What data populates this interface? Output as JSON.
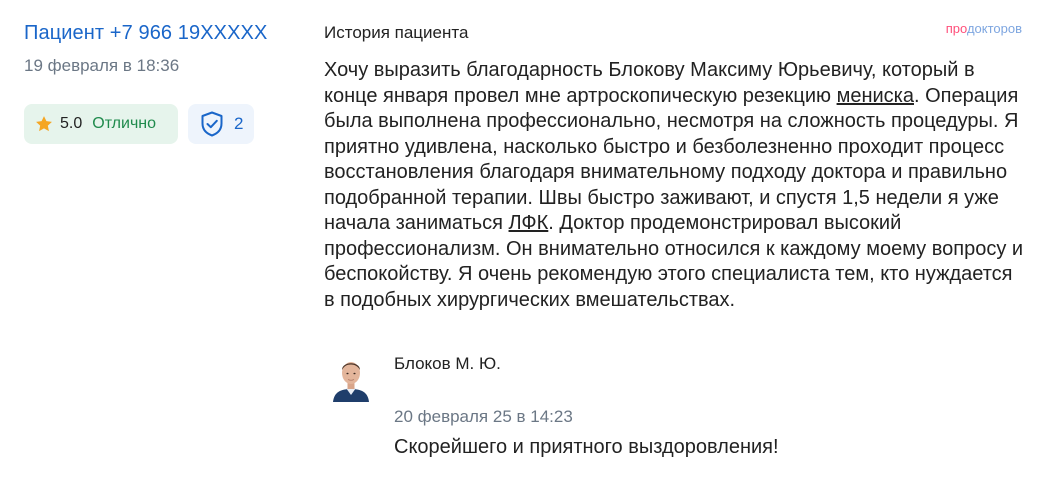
{
  "patient": {
    "name": "Пациент +7 966 19XXXXX",
    "date": "19 февраля в 18:36"
  },
  "rating": {
    "value": "5.0",
    "word": "Отлично",
    "star_color": "#f5a623"
  },
  "verification": {
    "count": "2",
    "icon": "shield-check-icon"
  },
  "section": {
    "title": "История пациента"
  },
  "brand": {
    "pro": "про",
    "rest": "докторов"
  },
  "review": {
    "part1": "Хочу выразить благодарность Блокову Максиму Юрьевичу, который в конце января провел мне артроскопическую резекцию ",
    "link1": "мениска",
    "part2": ". Операция была выполнена профессионально, несмотря на сложность процедуры. Я приятно удивлена, насколько быстро и безболезненно проходит процесс восстановления благодаря внимательному подходу доктора и правильно подобранной терапии. Швы быстро заживают, и спустя 1,5 недели я уже начала заниматься ",
    "link2": "ЛФК",
    "part3": ". Доктор продемонстрировал высокий профессионализм. Он внимательно относился к каждому моему вопросу и беспокойству. Я очень рекомендую этого специалиста тем, кто нуждается в подобных хирургических вмешательствах."
  },
  "reply": {
    "doctor_name": "Блоков М. Ю.",
    "date": "20 февраля 25 в 14:23",
    "text": "Скорейшего и приятного выздоровления!"
  },
  "colors": {
    "link_blue": "#1a66c9",
    "rating_bg": "#e6f4ec",
    "rating_green": "#1f8a4c",
    "muted_gray": "#6b7785",
    "brand_pink": "#ff4f7a",
    "brand_blue": "#7ea6e0"
  }
}
